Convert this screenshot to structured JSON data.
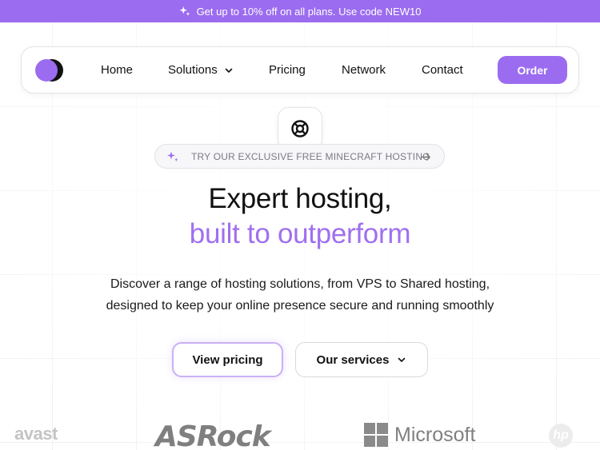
{
  "promo": {
    "icon": "sparkles-icon",
    "text": "Get up to 10% off on all plans. Use code NEW10"
  },
  "nav": {
    "logo_icon": "brand-logo",
    "items": [
      {
        "label": "Home"
      },
      {
        "label": "Solutions",
        "icon": "chevron-down-icon"
      },
      {
        "label": "Pricing"
      },
      {
        "label": "Network"
      },
      {
        "label": "Contact"
      }
    ],
    "order_label": "Order"
  },
  "hero": {
    "badge_icon": "lifebuoy-icon",
    "pill_text": "TRY OUR EXCLUSIVE FREE MINECRAFT HOSTING",
    "title_line1": "Expert hosting,",
    "title_line2": "built to outperform",
    "subtitle_line1": "Discover a range of hosting solutions, from VPS to Shared hosting,",
    "subtitle_line2": "designed to keep your online presence secure and running smoothly",
    "primary_button": "View pricing",
    "secondary_button": "Our services"
  },
  "brands": {
    "avast": "avast",
    "asrock": "ASRock",
    "microsoft": "Microsoft",
    "hp": "hp"
  },
  "colors": {
    "accent": "#9b6cf0",
    "accent_text": "#a070ee"
  }
}
